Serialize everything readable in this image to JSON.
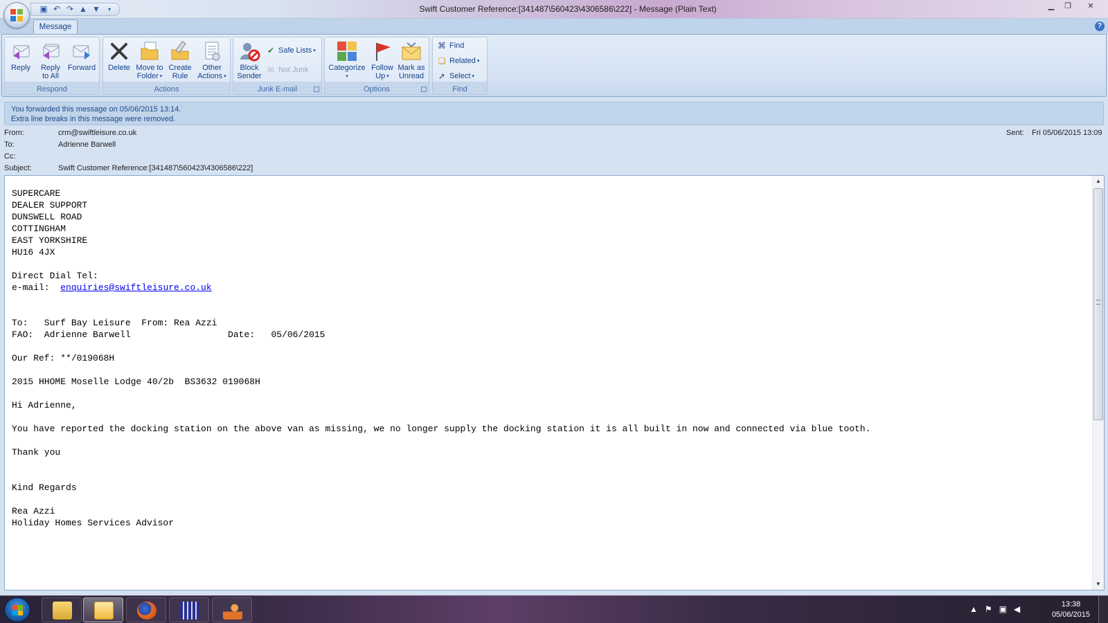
{
  "window": {
    "title": "Swift Customer Reference:[341487\\560423\\4306586\\222] - Message (Plain Text)"
  },
  "ribbon": {
    "tab_label": "Message",
    "groups": {
      "respond": {
        "label": "Respond",
        "reply": "Reply",
        "reply_all_1": "Reply",
        "reply_all_2": "to All",
        "forward": "Forward"
      },
      "actions": {
        "label": "Actions",
        "delete": "Delete",
        "move_1": "Move to",
        "move_2": "Folder",
        "create_1": "Create",
        "create_2": "Rule",
        "other_1": "Other",
        "other_2": "Actions"
      },
      "junk": {
        "label": "Junk E-mail",
        "block_1": "Block",
        "block_2": "Sender",
        "safe_lists": "Safe Lists",
        "not_junk": "Not Junk"
      },
      "options": {
        "label": "Options",
        "categorize": "Categorize",
        "follow_1": "Follow",
        "follow_2": "Up",
        "mark_1": "Mark as",
        "mark_2": "Unread"
      },
      "find": {
        "label": "Find",
        "find": "Find",
        "related": "Related",
        "select": "Select"
      }
    }
  },
  "infobar": {
    "line1": "You forwarded this message on 05/06/2015 13:14.",
    "line2": "Extra line breaks in this message were removed."
  },
  "header": {
    "from_label": "From:",
    "from_value": "crm@swiftleisure.co.uk",
    "to_label": "To:",
    "to_value": "Adrienne Barwell",
    "cc_label": "Cc:",
    "cc_value": "",
    "subject_label": "Subject:",
    "subject_value": "Swift Customer Reference:[341487\\560423\\4306586\\222]",
    "sent_label": "Sent:",
    "sent_value": "Fri 05/06/2015 13:09"
  },
  "body": {
    "address": "SUPERCARE\nDEALER SUPPORT\nDUNSWELL ROAD\nCOTTINGHAM\nEAST YORKSHIRE\nHU16 4JX\n\nDirect Dial Tel:",
    "email_label": "e-mail:  ",
    "email_link": "enquiries@swiftleisure.co.uk",
    "main": "\n\n\nTo:   Surf Bay Leisure  From: Rea Azzi\nFAO:  Adrienne Barwell                  Date:   05/06/2015\n\nOur Ref: **/019068H\n\n2015 HHOME Moselle Lodge 40/2b  BS3632 019068H\n\nHi Adrienne,\n\nYou have reported the docking station on the above van as missing, we no longer supply the docking station it is all built in now and connected via blue tooth.\n\nThank you\n\n\nKind Regards\n\nRea Azzi\nHoliday Homes Services Advisor"
  },
  "taskbar": {
    "time": "13:38",
    "date": "05/06/2015"
  },
  "colors": {
    "ribbon_text": "#15428b",
    "link": "#0000ee",
    "infobar": "#c0d4ea"
  }
}
